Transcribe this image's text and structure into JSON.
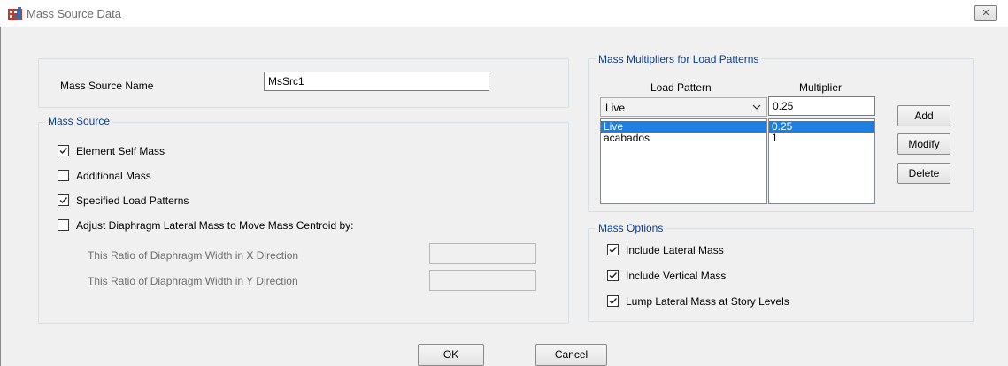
{
  "window": {
    "title": "Mass Source Data",
    "close_glyph": "✕"
  },
  "mass_source_name": {
    "label": "Mass Source Name",
    "value": "MsSrc1"
  },
  "mass_source": {
    "legend": "Mass Source",
    "element_self_mass": {
      "label": "Element Self Mass",
      "checked": true
    },
    "additional_mass": {
      "label": "Additional Mass",
      "checked": false
    },
    "specified_load_patterns": {
      "label": "Specified Load Patterns",
      "checked": true
    },
    "adjust_diaphragm": {
      "label": "Adjust Diaphragm Lateral Mass to Move Mass Centroid by:",
      "checked": false
    },
    "ratio_x_label": "This Ratio of Diaphragm Width in X Direction",
    "ratio_x_value": "",
    "ratio_y_label": "This Ratio of Diaphragm Width in Y Direction",
    "ratio_y_value": ""
  },
  "multipliers": {
    "legend": "Mass Multipliers for Load Patterns",
    "col_load_pattern": "Load Pattern",
    "col_multiplier": "Multiplier",
    "load_pattern_selected": "Live",
    "multiplier_value": "0.25",
    "rows": [
      {
        "pattern": "Live",
        "multiplier": "0.25",
        "selected": true
      },
      {
        "pattern": "acabados",
        "multiplier": "1",
        "selected": false
      }
    ],
    "add_label": "Add",
    "modify_label": "Modify",
    "delete_label": "Delete"
  },
  "mass_options": {
    "legend": "Mass Options",
    "include_lateral": {
      "label": "Include Lateral Mass",
      "checked": true
    },
    "include_vertical": {
      "label": "Include Vertical Mass",
      "checked": true
    },
    "lump_lateral": {
      "label": "Lump Lateral Mass at Story Levels",
      "checked": true
    }
  },
  "footer": {
    "ok_label": "OK",
    "cancel_label": "Cancel"
  }
}
